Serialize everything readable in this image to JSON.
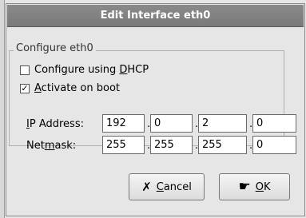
{
  "window": {
    "title": "Edit Interface eth0"
  },
  "group": {
    "title": "Configure eth0"
  },
  "options": {
    "dhcp": {
      "label_pre": "Configure using ",
      "label_u": "D",
      "label_post": "HCP",
      "checked": false,
      "mark": ""
    },
    "boot": {
      "label_pre": "",
      "label_u": "A",
      "label_post": "ctivate on boot",
      "checked": true,
      "mark": "✓"
    }
  },
  "ip": {
    "label_u": "I",
    "label_post": "P Address:",
    "octets": [
      "192",
      "0",
      "2",
      "0"
    ]
  },
  "netmask": {
    "label_pre": "Net",
    "label_u": "m",
    "label_post": "ask:",
    "octets": [
      "255",
      "255",
      "255",
      "0"
    ]
  },
  "separator": ".",
  "buttons": {
    "cancel": {
      "u": "C",
      "rest": "ancel",
      "icon": "✗"
    },
    "ok": {
      "u": "O",
      "rest": "K",
      "icon": "☛"
    }
  }
}
